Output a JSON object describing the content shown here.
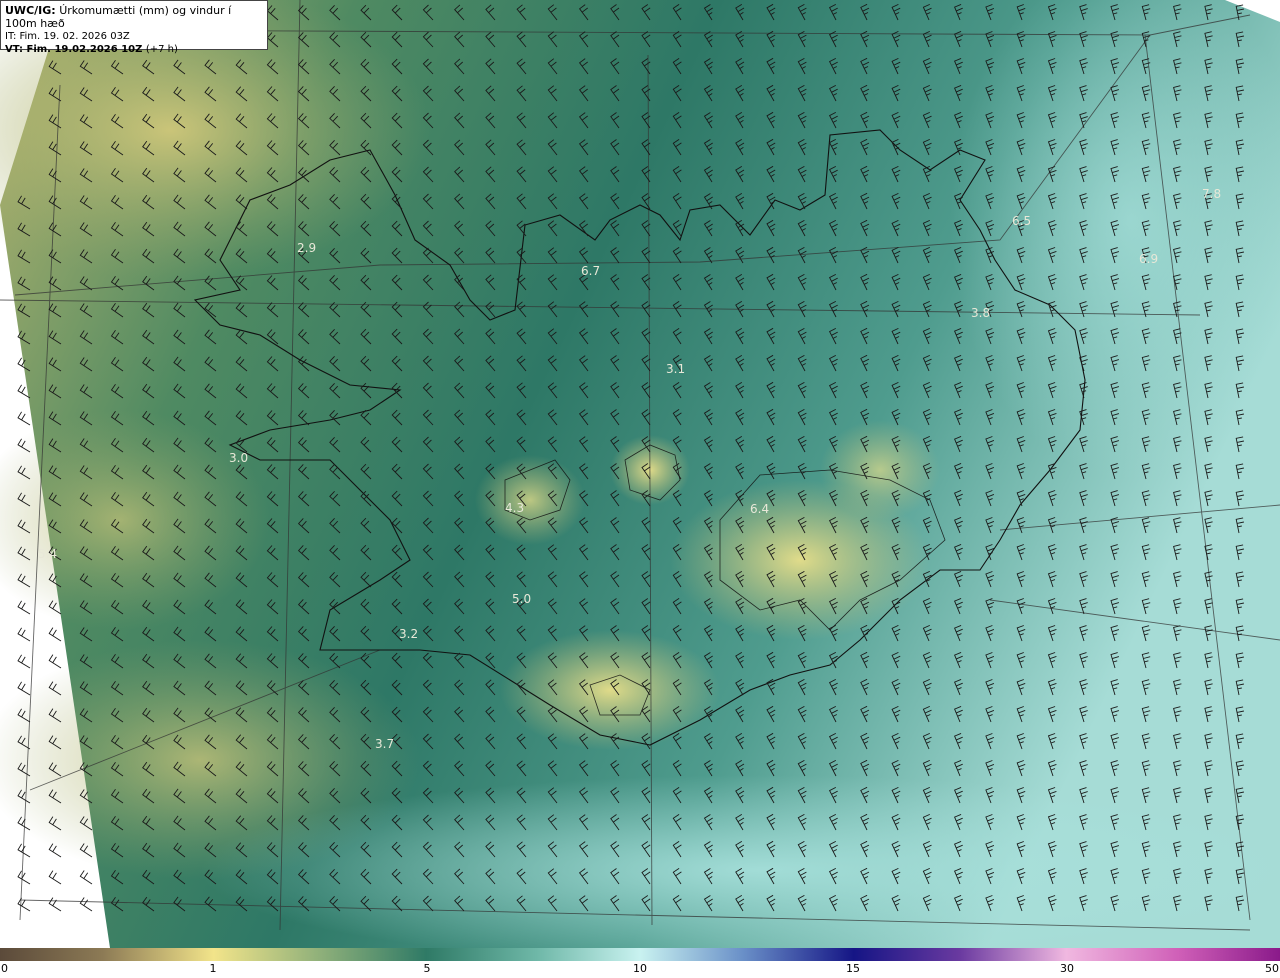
{
  "title": {
    "product": "UWC/IG:",
    "description": "Úrkomumætti (mm) og vindur í 100m hæð",
    "initial_time": "IT: Fim. 19. 02. 2026 03Z",
    "valid_label": "VT:",
    "valid_time": "Fim. 19.02.2026 10Z",
    "lead": "(+7 h)"
  },
  "value_labels": [
    {
      "text": "2.9"
    },
    {
      "text": "6.7"
    },
    {
      "text": "3.1"
    },
    {
      "text": "3.8"
    },
    {
      "text": "3.0"
    },
    {
      "text": "5.4"
    },
    {
      "text": "4.3"
    },
    {
      "text": "5.0"
    },
    {
      "text": "3.2"
    },
    {
      "text": "3.7"
    },
    {
      "text": "6.4"
    },
    {
      "text": "7.8"
    },
    {
      "text": "6.5"
    },
    {
      "text": "6.9"
    }
  ],
  "colorbar": {
    "ticks": [
      "0",
      "1",
      "5",
      "10",
      "15",
      "30",
      "50"
    ]
  },
  "colors": {
    "low": "#c9c27a",
    "mid": "#2f7a66",
    "high": "#b8ecec",
    "coast": "#111111"
  }
}
